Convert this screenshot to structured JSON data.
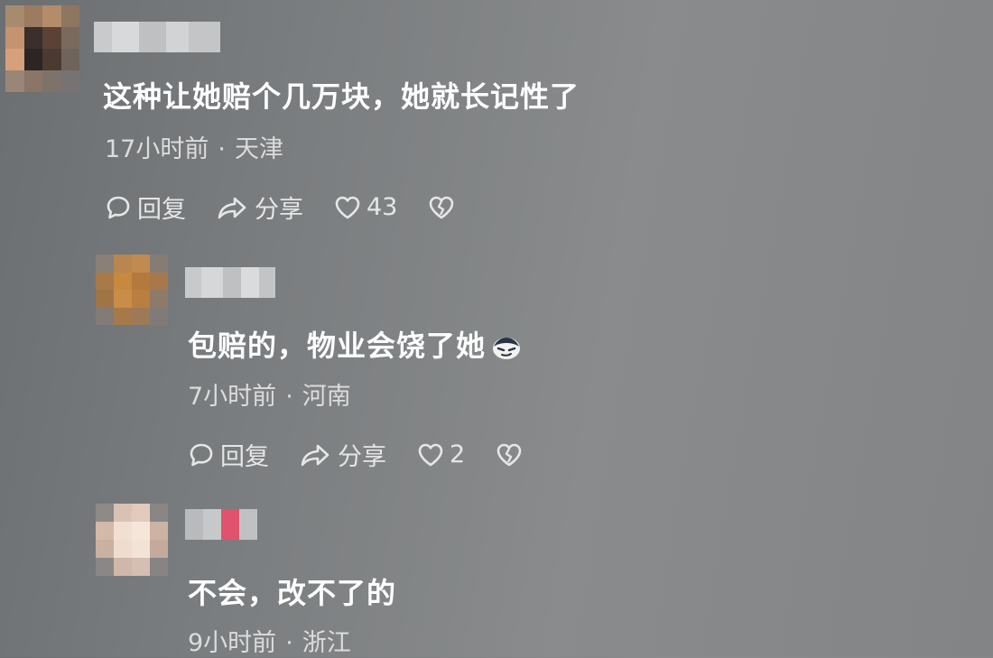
{
  "comments": [
    {
      "text": "这种让她赔个几万块，她就长记性了",
      "time": "17小时前",
      "location": "天津",
      "reply_label": "回复",
      "share_label": "分享",
      "likes": "43"
    },
    {
      "text": "包赔的，物业会饶了她",
      "time": "7小时前",
      "location": "河南",
      "reply_label": "回复",
      "share_label": "分享",
      "likes": "2"
    },
    {
      "text": "不会，改不了的",
      "time": "9小时前",
      "location": "浙江"
    }
  ],
  "separator": "·",
  "icons": {
    "reply": "comment-bubble-icon",
    "share": "share-arrow-icon",
    "like": "heart-icon",
    "dislike": "broken-heart-icon",
    "emoji": "smirk-face-emoji-icon"
  },
  "colors": {
    "text": "#ffffff",
    "meta": "#dcdcdc"
  }
}
